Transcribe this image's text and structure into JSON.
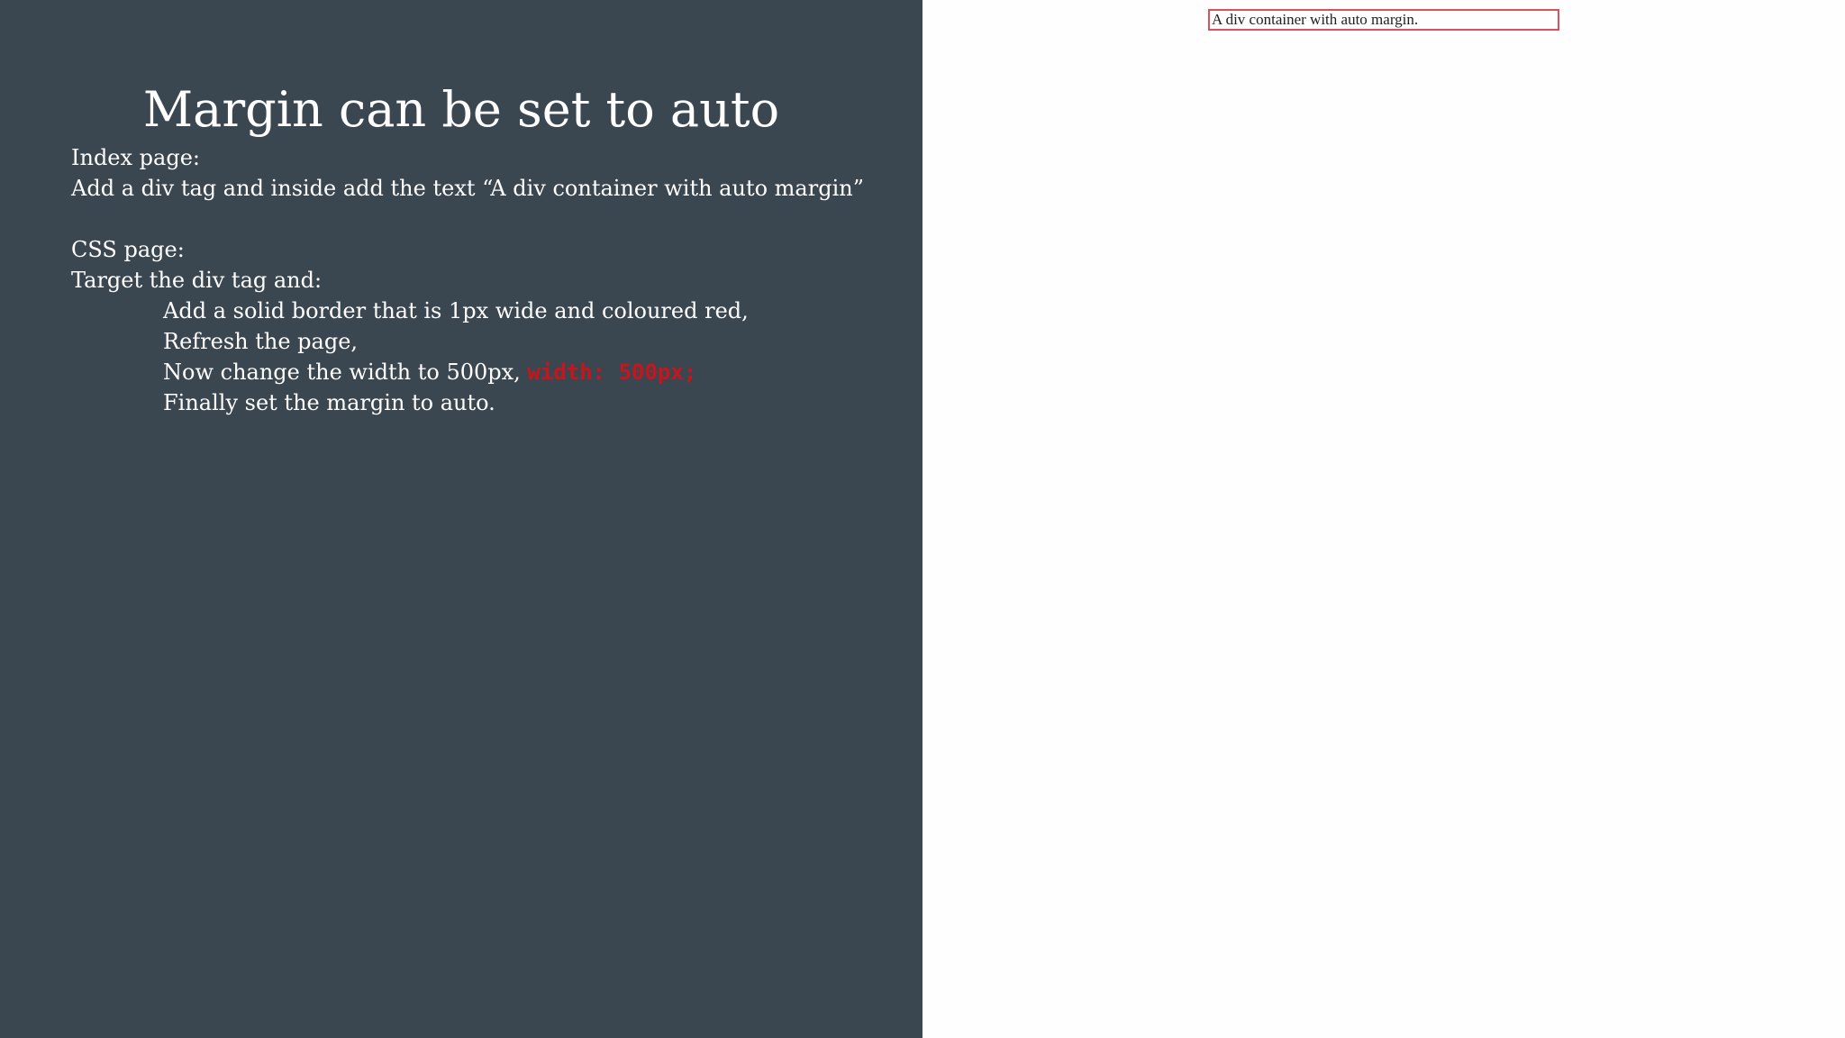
{
  "slide": {
    "title": "Margin can be set to auto",
    "lines": {
      "index_heading": "Index page:",
      "index_instruction": "Add a div tag and inside add the text “A div container with auto margin”",
      "css_heading": "CSS page:",
      "target_instruction": "Target the div tag and:",
      "step_border": "Add a solid border that is 1px wide and coloured red,",
      "step_refresh": "Refresh the page,",
      "step_width": "Now change the width to 500px, ",
      "step_width_code": "width: 500px;",
      "step_margin": "Finally set the margin to auto."
    }
  },
  "demo": {
    "div_text": "A div container with auto margin."
  },
  "colors": {
    "left_background": "#3a4650",
    "text": "#ffffff",
    "code_highlight": "#c8151d",
    "demo_border": "#d9515f"
  }
}
